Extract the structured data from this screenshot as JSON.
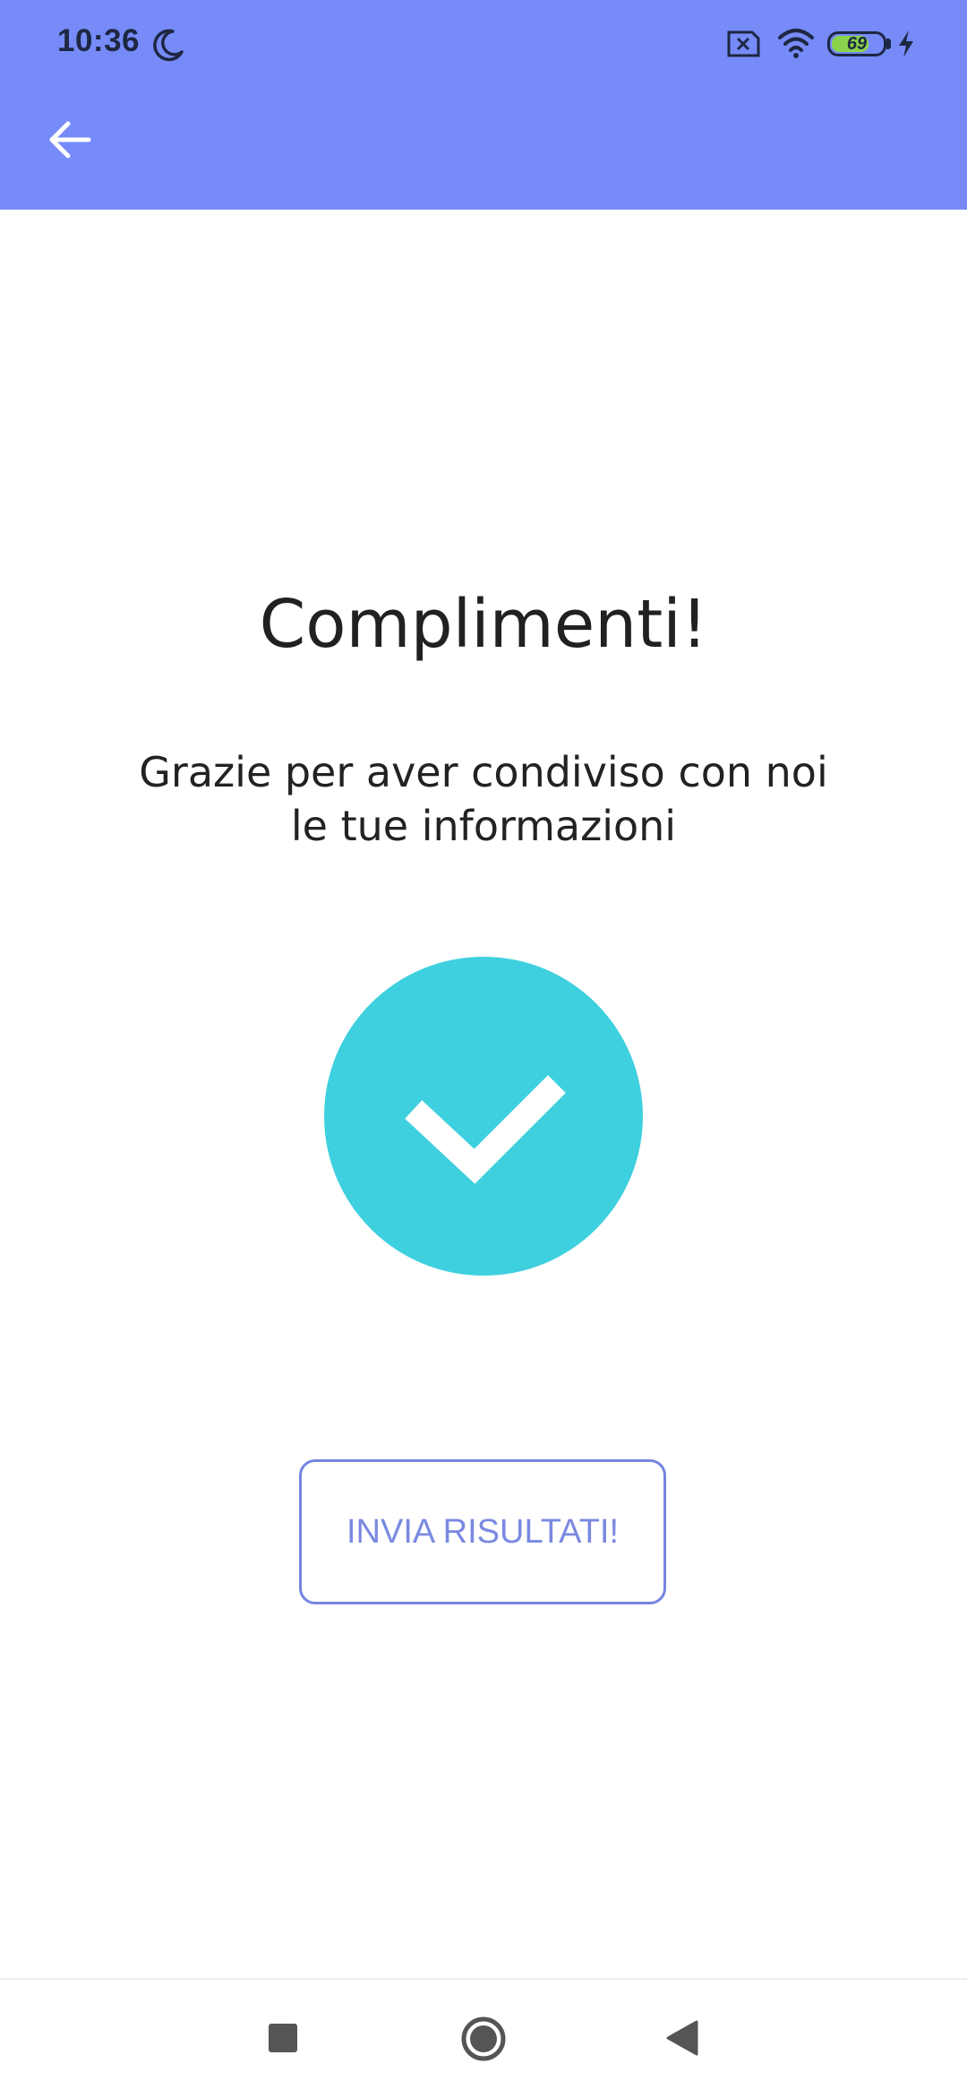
{
  "status_bar": {
    "time": "10:36",
    "battery_level": "69",
    "battery_fraction": 0.69,
    "icons": [
      "moon-icon",
      "sim-blocked-icon",
      "wifi-icon",
      "battery-icon",
      "charging-bolt-icon"
    ]
  },
  "toolbar": {
    "back_icon": "arrow-left-icon"
  },
  "main": {
    "title": "Complimenti!",
    "subtitle_line1": "Grazie per aver condiviso con noi",
    "subtitle_line2": "le tue informazioni",
    "success_icon": "check-circle-icon",
    "send_button_label": "INVIA RISULTATI!"
  },
  "nav_bar": {
    "icons": [
      "recents-square-icon",
      "home-circle-icon",
      "back-triangle-icon"
    ]
  },
  "colors": {
    "header": "#768bf8",
    "check_circle": "#3ed0de",
    "button_outline": "#7585e0",
    "text_primary": "#212121"
  }
}
